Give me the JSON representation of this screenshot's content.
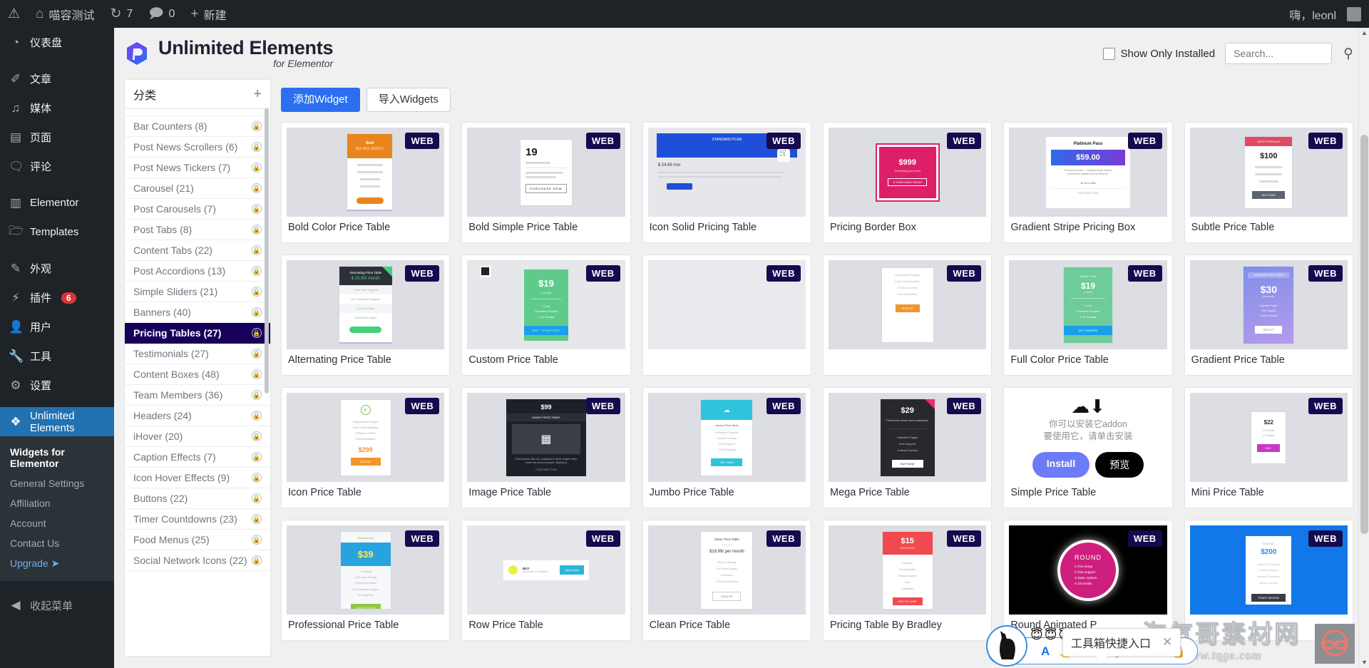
{
  "adminbar": {
    "wp_logo_icon": "wordpress-icon",
    "site_icon": "home-icon",
    "site_name": "喵容测试",
    "updates_icon": "updates-icon",
    "updates_count": "7",
    "comments_icon": "comment-icon",
    "comments_count": "0",
    "new_icon": "plus-icon",
    "new_label": "新建",
    "account_greeting": "嗨，leonl",
    "avatar_icon": "avatar"
  },
  "sidebar": {
    "items": [
      {
        "label": "仪表盘",
        "icon": "dashboard-icon",
        "sep": false
      },
      {
        "label": "文章",
        "icon": "pin-icon",
        "sep": true
      },
      {
        "label": "媒体",
        "icon": "media-icon",
        "sep": false
      },
      {
        "label": "页面",
        "icon": "page-icon",
        "sep": false
      },
      {
        "label": "评论",
        "icon": "comment-icon",
        "sep": false
      },
      {
        "label": "Elementor",
        "icon": "elementor-icon",
        "sep": true
      },
      {
        "label": "Templates",
        "icon": "folder-icon",
        "sep": false
      },
      {
        "label": "外观",
        "icon": "brush-icon",
        "sep": true
      },
      {
        "label": "插件",
        "icon": "plugin-icon",
        "sep": false,
        "badge": "6"
      },
      {
        "label": "用户",
        "icon": "user-icon",
        "sep": false
      },
      {
        "label": "工具",
        "icon": "wrench-icon",
        "sep": false
      },
      {
        "label": "设置",
        "icon": "settings-icon",
        "sep": false
      },
      {
        "label": "Unlimited Elements",
        "icon": "unlimited-elements-icon",
        "sep": true,
        "current": true
      }
    ],
    "submenu": [
      {
        "label": "Widgets for Elementor",
        "active": true
      },
      {
        "label": "General Settings",
        "active": false
      },
      {
        "label": "Affiliation",
        "active": false
      },
      {
        "label": "Account",
        "active": false
      },
      {
        "label": "Contact Us",
        "active": false
      },
      {
        "label": "Upgrade ➤",
        "active": false,
        "upgrade": true
      }
    ],
    "collapse_label": "收起菜单",
    "collapse_icon": "collapse-icon"
  },
  "plugin_header": {
    "logo_title": "Unlimited Elements",
    "logo_subtitle": "for Elementor",
    "show_only_installed_label": "Show Only Installed",
    "show_only_installed_checked": false,
    "search_placeholder": "Search...",
    "search_value": "",
    "search_icon": "search-icon"
  },
  "categories": {
    "title": "分类",
    "add_icon": "plus-icon",
    "items": [
      {
        "label": "Bar Counters (8)",
        "locked": true
      },
      {
        "label": "Post News Scrollers (6)",
        "locked": true
      },
      {
        "label": "Post News Tickers (7)",
        "locked": true
      },
      {
        "label": "Carousel (21)",
        "locked": true
      },
      {
        "label": "Post Carousels (7)",
        "locked": true
      },
      {
        "label": "Post Tabs (8)",
        "locked": true
      },
      {
        "label": "Content Tabs (22)",
        "locked": true
      },
      {
        "label": "Post Accordions (13)",
        "locked": true
      },
      {
        "label": "Simple Sliders (21)",
        "locked": true
      },
      {
        "label": "Banners (40)",
        "locked": true
      },
      {
        "label": "Pricing Tables (27)",
        "locked": true,
        "selected": true
      },
      {
        "label": "Testimonials (27)",
        "locked": true
      },
      {
        "label": "Content Boxes (48)",
        "locked": true
      },
      {
        "label": "Team Members (36)",
        "locked": true
      },
      {
        "label": "Headers (24)",
        "locked": true
      },
      {
        "label": "iHover (20)",
        "locked": true
      },
      {
        "label": "Caption Effects (7)",
        "locked": true
      },
      {
        "label": "Icon Hover Effects (9)",
        "locked": true
      },
      {
        "label": "Buttons (22)",
        "locked": true
      },
      {
        "label": "Timer Countdowns (23)",
        "locked": true
      },
      {
        "label": "Food Menus (25)",
        "locked": true
      },
      {
        "label": "Social Network Icons (22)",
        "locked": true
      }
    ]
  },
  "toolbar": {
    "add_widget_label": "添加Widget",
    "import_widgets_label": "导入Widgets"
  },
  "widgets": {
    "badge_label": "WEB",
    "install_card": {
      "cloud_icon": "cloud-download-icon",
      "message_line1": "你可以安装它addon",
      "message_line2": "要使用它，请单击安装",
      "install_label": "Install",
      "preview_label": "预览"
    },
    "items": [
      {
        "title": "Bold Color Price Table",
        "style": "bold-color"
      },
      {
        "title": "Bold Simple Price Table",
        "style": "bold-simple"
      },
      {
        "title": "Icon Solid Pricing Table",
        "style": "icon-solid"
      },
      {
        "title": "Pricing Border Box",
        "style": "pricing-border"
      },
      {
        "title": "Gradient Stripe Pricing Box",
        "style": "gradient-stripe"
      },
      {
        "title": "Subtle Price Table",
        "style": "subtle"
      },
      {
        "title": "Alternating Price Table",
        "style": "alternating"
      },
      {
        "title": "Custom Price Table",
        "style": "custom"
      },
      {
        "title": "",
        "style": "blank"
      },
      {
        "title": "",
        "style": "light"
      },
      {
        "title": "Full Color Price Table",
        "style": "full-color"
      },
      {
        "title": "Gradient Price Table",
        "style": "gradient"
      },
      {
        "title": "Icon Price Table",
        "style": "icon"
      },
      {
        "title": "Image Price Table",
        "style": "image"
      },
      {
        "title": "Jumbo Price Table",
        "style": "jumbo"
      },
      {
        "title": "Mega Price Table",
        "style": "mega"
      },
      {
        "title": "Simple Price Table",
        "style": "install"
      },
      {
        "title": "Mini Price Table",
        "style": "mini"
      },
      {
        "title": "Professional Price Table",
        "style": "professional"
      },
      {
        "title": "Row Price Table",
        "style": "row"
      },
      {
        "title": "Clean Price Table",
        "style": "clean"
      },
      {
        "title": "Pricing Table By Bradley",
        "style": "bradley"
      },
      {
        "title": "Round Animated P",
        "style": "round"
      },
      {
        "title": "",
        "style": "blue-gold"
      }
    ],
    "previews": {
      "bold_color_cap_1": "Bold",
      "bold_color_cap_2": "$19 INCL BOOST",
      "bold_simple_price": "19",
      "icon_solid_header": "STANDARD PLAN",
      "icon_solid_price": "$ 24.99 /mo",
      "pricing_border_price": "$999",
      "gradient_stripe_title": "Platinum Pass",
      "gradient_stripe_price": "$59.00",
      "subtle_price": "$100",
      "alternating_title": "Alternating Price Table",
      "alternating_price": "$ 29.99/ month",
      "custom_price": "$19",
      "custom_cta": "GET STARTED",
      "full_color_price": "$19",
      "full_color_cta": "GET STARTED",
      "gradient_title": "GRADIENT PRICE TABLE",
      "gradient_price": "$30",
      "icon_price": "$299",
      "image_price": "$99",
      "image_label": "IMAGE PRICE TABLE",
      "mega_price": "$29",
      "mini_price": "$22",
      "professional_label": "Professional",
      "professional_price": "$39",
      "row_label": "BUY",
      "row_cta": "Select plan",
      "clean_title": "Clean Price Table",
      "clean_price": "$19.99/ per month",
      "bradley_price": "$15",
      "round_title": "ROUND",
      "round_features": [
        "free setup",
        "free support",
        "basic options",
        "25 emails"
      ],
      "blue_gold_label": "GOLD",
      "blue_gold_price": "$200",
      "blue_gold_cta": "START DESIGN"
    }
  },
  "overlay": {
    "tip_text": "工具箱快捷入口",
    "tip_close_icon": "close-icon",
    "toolbar_icons": [
      "font-icon",
      "moon-icon",
      "dots-icon",
      "wrench-icon",
      "smiley-icon",
      "apps-grid-icon",
      "lock-icon"
    ],
    "emoji": [
      "😇",
      "😇",
      "😇"
    ],
    "watermark_main": "淘气哥素材网",
    "watermark_sub": "www.tqge.com",
    "watermark_logo_icon": "glasses-avatar-icon"
  }
}
